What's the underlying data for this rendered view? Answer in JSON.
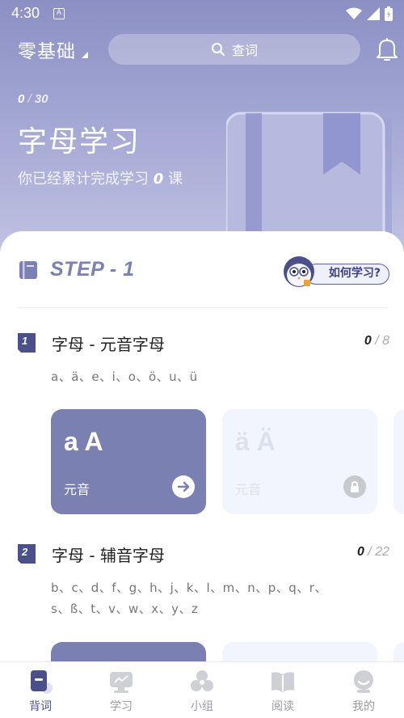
{
  "status_bar": {
    "time": "4:30",
    "notice_glyph": "A"
  },
  "header": {
    "level": "零基础",
    "search_placeholder": "查词"
  },
  "hero": {
    "done": "0",
    "sep": "/",
    "total": "30",
    "title": "字母学习",
    "sub_prefix": "你已经累计完成学习",
    "sub_count": "0",
    "sub_suffix": "课"
  },
  "step": {
    "label": "STEP - 1",
    "howto_label": "如何学习?"
  },
  "sections": [
    {
      "num": "1",
      "title": "字母 - 元音字母",
      "done": "0",
      "total": "8",
      "letters_line1": "a、ä、e、i、o、ö、u、ü",
      "letters_line2": "",
      "cards": [
        {
          "big": "a A",
          "small": "元音",
          "state": "active"
        },
        {
          "big": "ä Ä",
          "small": "元音",
          "state": "locked"
        }
      ]
    },
    {
      "num": "2",
      "title": "字母 - 辅音字母",
      "done": "0",
      "total": "22",
      "letters_line1": "b、c、d、f、g、h、j、k、l、m、n、p、q、r、",
      "letters_line2": "s、ß、t、v、w、x、y、z"
    }
  ],
  "tabs": [
    {
      "label": "背词",
      "active": true
    },
    {
      "label": "学习",
      "active": false
    },
    {
      "label": "小组",
      "active": false
    },
    {
      "label": "阅读",
      "active": false
    },
    {
      "label": "我的",
      "active": false
    }
  ],
  "colors": {
    "accent": "#7b80b2",
    "hero_top": "#8b8fc4",
    "dark_accent": "#4c508a"
  }
}
